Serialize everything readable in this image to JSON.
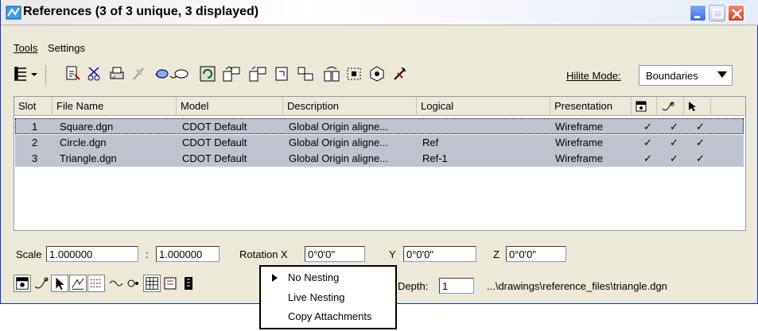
{
  "window": {
    "title": "References (3 of 3 unique, 3 displayed)"
  },
  "menubar": {
    "items": [
      {
        "label": "Tools"
      },
      {
        "label": "Settings"
      }
    ]
  },
  "toolbar": {
    "hilite_label": "Hilite Mode:",
    "hilite_value": "Boundaries"
  },
  "table": {
    "columns": [
      "Slot",
      "File Name",
      "Model",
      "Description",
      "Logical",
      "Presentation"
    ],
    "rows": [
      {
        "slot": "1",
        "file": "Square.dgn",
        "model": "CDOT Default",
        "description": "Global Origin aligne...",
        "logical": "",
        "presentation": "Wireframe",
        "c1": "✓",
        "c2": "✓",
        "c3": "✓"
      },
      {
        "slot": "2",
        "file": "Circle.dgn",
        "model": "CDOT Default",
        "description": "Global Origin aligne...",
        "logical": "Ref",
        "presentation": "Wireframe",
        "c1": "✓",
        "c2": "✓",
        "c3": "✓"
      },
      {
        "slot": "3",
        "file": "Triangle.dgn",
        "model": "CDOT Default",
        "description": "Global Origin aligne...",
        "logical": "Ref-1",
        "presentation": "Wireframe",
        "c1": "✓",
        "c2": "✓",
        "c3": "✓"
      }
    ]
  },
  "bottom": {
    "scale_label": "Scale",
    "scale1": "1.000000",
    "colon": ":",
    "scale2": "1.000000",
    "rotation_label": "Rotation X",
    "rot_x": "0°0'0\"",
    "y_label": "Y",
    "rot_y": "0°0'0\"",
    "z_label": "Z",
    "rot_z": "0°0'0\"",
    "depth_label": "Depth:",
    "depth_value": "1",
    "path": "...\\drawings\\reference_files\\triangle.dgn"
  },
  "popup": {
    "items": [
      "No Nesting",
      "Live Nesting",
      "Copy Attachments"
    ]
  },
  "colors": {
    "selection": "#bfc3cf",
    "panel": "#ece9d8"
  }
}
